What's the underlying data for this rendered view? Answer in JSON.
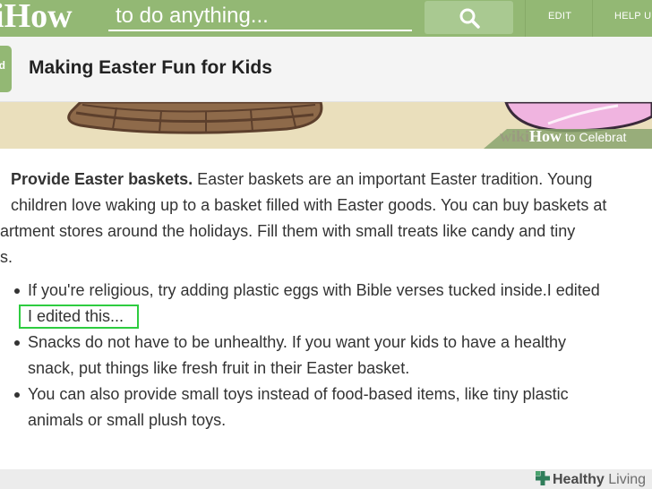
{
  "topbar": {
    "logo_prefix": "i",
    "logo_text": "How",
    "search_placeholder": "to do anything...",
    "search_icon": "search-icon",
    "nav": [
      "EDIT",
      "HELP U"
    ]
  },
  "header": {
    "step_tab": "d",
    "title": "Making Easter Fun for Kids"
  },
  "illustration": {
    "watermark_a": "wiki",
    "watermark_b": "How",
    "watermark_c": " to Celebrat"
  },
  "step": {
    "bold": "Provide Easter baskets.",
    "line1_rest": " Easter baskets are an important Easter tradition. Young",
    "line2": "children love waking up to a basket filled with Easter goods. You can buy baskets at",
    "line3": "artment stores around the holidays. Fill them with small treats like candy and tiny",
    "line4": "s."
  },
  "bullets": [
    {
      "line1": "If you're religious, try adding plastic eggs with Bible verses tucked inside.I edited",
      "line2a": "I edited",
      "line2b": " this..."
    },
    {
      "line1": "Snacks do not have to be unhealthy. If you want your kids to have a healthy",
      "line2": "snack, put things like fresh fruit in their Easter basket."
    },
    {
      "line1": "You can also provide small toys instead of food-based items, like tiny plastic",
      "line2": "animals or small plush toys."
    }
  ],
  "footer": {
    "logo_a": "Healthy",
    "logo_b": " Living"
  },
  "colors": {
    "brand_green": "#93b874",
    "edit_outline": "#2ecc40"
  }
}
